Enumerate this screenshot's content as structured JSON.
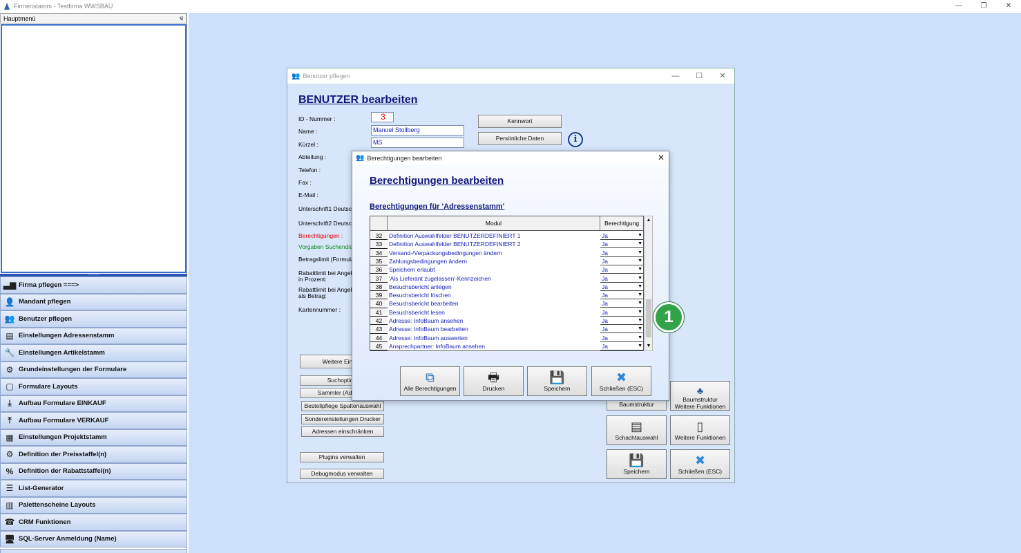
{
  "main_window": {
    "title": "Firmenstamm - Testfirma WWSBAU",
    "minimize": "—",
    "restore": "❐",
    "close": "✕"
  },
  "sidepanel": {
    "header": "Hauptmenü",
    "pin": "⪨",
    "splitter_dots": "..........",
    "footer_chevron": "»",
    "items": [
      {
        "label": "Firma pflegen   ===>",
        "icon": "factory-icon",
        "glyph": "▃▆"
      },
      {
        "label": "Mandant pflegen",
        "icon": "user-icon",
        "glyph": "👤"
      },
      {
        "label": "Benutzer pflegen",
        "icon": "users-icon",
        "glyph": "👥"
      },
      {
        "label": "Einstellungen Adressenstamm",
        "icon": "address-card-icon",
        "glyph": "▤"
      },
      {
        "label": "Einstellungen Artikelstamm",
        "icon": "drill-icon",
        "glyph": "🔧"
      },
      {
        "label": "Grundeinstellungen der Formulare",
        "icon": "form-settings-icon",
        "glyph": "⚙"
      },
      {
        "label": "Formulare Layouts",
        "icon": "document-icon",
        "glyph": "▢"
      },
      {
        "label": "Aufbau Formulare EINKAUF",
        "icon": "tray-in-icon",
        "glyph": "⤓"
      },
      {
        "label": "Aufbau Formulare VERKAUF",
        "icon": "tray-out-icon",
        "glyph": "⤒"
      },
      {
        "label": "Einstellungen Projektstamm",
        "icon": "projects-icon",
        "glyph": "▦"
      },
      {
        "label": "Definition der Preisstaffel(n)",
        "icon": "price-gear-icon",
        "glyph": "⚙"
      },
      {
        "label": "Definition der Rabattstaffel(n)",
        "icon": "discount-icon",
        "glyph": "%"
      },
      {
        "label": "List-Generator",
        "icon": "list-icon",
        "glyph": "☰"
      },
      {
        "label": "Palettenscheine Layouts",
        "icon": "pallet-icon",
        "glyph": "▥"
      },
      {
        "label": "CRM Funktionen",
        "icon": "crm-icon",
        "glyph": "☎"
      },
      {
        "label": "SQL-Server Anmeldung (Name)",
        "icon": "server-icon",
        "glyph": "🖥"
      }
    ]
  },
  "benutzer_window": {
    "title": "Benutzer pflegen",
    "heading": "BENUTZER bearbeiten",
    "labels": {
      "id": "ID - Nummer :",
      "name": "Name :",
      "kuerzel": "Kürzel :",
      "abteilung": "Abteilung :",
      "telefon": "Telefon :",
      "fax": "Fax :",
      "email": "E-Mail :",
      "unterschrift1": "Unterschrift1 Deutsch",
      "unterschrift2": "Unterschrift2 Deutsch",
      "berechtigungen": "Berechtigungen :",
      "vorgaben": "Vorgaben Suchendial",
      "betragslimit": "Betragslimit (Formulare",
      "rabatt_prozent_1": "Rabattlimit bei Angebo",
      "rabatt_prozent_2": "in Prozent:",
      "rabatt_betrag_1": "Rabattlimit bei Angebo",
      "rabatt_betrag_2": "als Betrag:",
      "kartennummer": "Kartennummer :"
    },
    "values": {
      "id": "3",
      "name": "Manuel Stollberg",
      "kuerzel": "MS"
    },
    "buttons": {
      "kennwort": "Kennwort",
      "persoenliche_daten": "Persönliche Daten",
      "weitere_einstellungen": "Weitere Einstel",
      "suchoptionen": "Suchoption",
      "sammler": "Sammler (Adresse",
      "bestellpflege": "Bestellpflege Spaltenauswahl",
      "sondereinstellungen": "Sondereinstellungen Drucker",
      "adressen_einschraenken": "Adressen einschränken",
      "plugins": "Plugins verwalten",
      "debugmodus": "Debugmodus verwalten",
      "baumstruktur": "Baumstruktur",
      "baumstruktur_weitere_1": "Baumstruktur",
      "baumstruktur_weitere_2": "Weitere Funktionen",
      "schachtauswahl": "Schachtauswahl",
      "weitere_funktionen": "Weitere Funktionen",
      "speichern": "Speichern",
      "schliessen": "Schließen (ESC)"
    }
  },
  "dialog": {
    "title": "Berechtigungen bearbeiten",
    "close": "✕",
    "heading": "Berechtigungen bearbeiten",
    "subheading": "Berechtigungen für 'Adressenstamm'",
    "columns": {
      "modul": "Modul",
      "berechtigung": "Berechtigung"
    },
    "rows": [
      {
        "nr": "32",
        "modul": "Definition Auswahlfelder BENUTZERDEFINIERT 1",
        "wert": "Ja"
      },
      {
        "nr": "33",
        "modul": "Definition Auswahlfelder BENUTZERDEFINIERT 2",
        "wert": "Ja"
      },
      {
        "nr": "34",
        "modul": "Versand-/Verpackungsbedingungen ändern",
        "wert": "Ja"
      },
      {
        "nr": "35",
        "modul": "Zahlungsbedingungen ändern",
        "wert": "Ja"
      },
      {
        "nr": "36",
        "modul": "Speichern erlaubt",
        "wert": "Ja"
      },
      {
        "nr": "37",
        "modul": "'Als Lieferant zugelassen'-Kennzeichen",
        "wert": "Ja"
      },
      {
        "nr": "38",
        "modul": "Besuchsbericht anlegen",
        "wert": "Ja"
      },
      {
        "nr": "39",
        "modul": "Besuchsbericht löschen",
        "wert": "Ja"
      },
      {
        "nr": "40",
        "modul": "Besuchsbericht bearbeiten",
        "wert": "Ja"
      },
      {
        "nr": "41",
        "modul": "Besuchsbericht lesen",
        "wert": "Ja"
      },
      {
        "nr": "42",
        "modul": "Adresse: InfoBaum ansehen",
        "wert": "Ja"
      },
      {
        "nr": "43",
        "modul": "Adresse: InfoBaum bearbeiten",
        "wert": "Ja"
      },
      {
        "nr": "44",
        "modul": "Adresse: InfoBaum auswerten",
        "wert": "Ja"
      },
      {
        "nr": "45",
        "modul": "Ansprechpartner: InfoBaum ansehen",
        "wert": "Ja"
      }
    ],
    "buttons": {
      "alle": "Alle Berechtigungen",
      "drucken": "Drucken",
      "speichern": "Speichern",
      "schliessen": "Schließen (ESC)"
    }
  },
  "marker": {
    "label": "1",
    "color": "#33a34a"
  }
}
